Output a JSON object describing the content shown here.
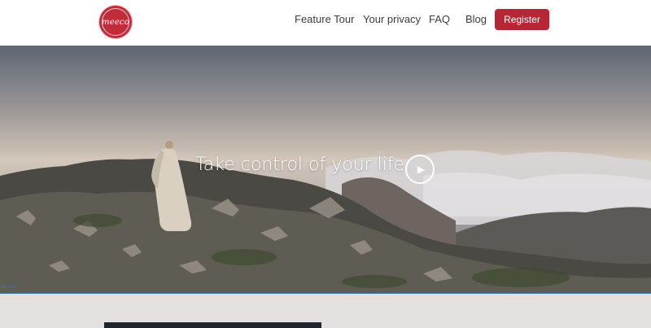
{
  "header": {
    "logo_text": "meeco",
    "nav": [
      {
        "label": "Feature Tour"
      },
      {
        "label": "Your privacy"
      },
      {
        "label": "FAQ"
      },
      {
        "label": "Blog"
      }
    ],
    "register_label": "Register"
  },
  "hero": {
    "title": "Take control of your life",
    "play_icon": "play-icon",
    "section_tag": "Section"
  },
  "colors": {
    "brand_red": "#b52735",
    "header_bg": "#ffffff",
    "page_bg": "#e3e0df"
  }
}
